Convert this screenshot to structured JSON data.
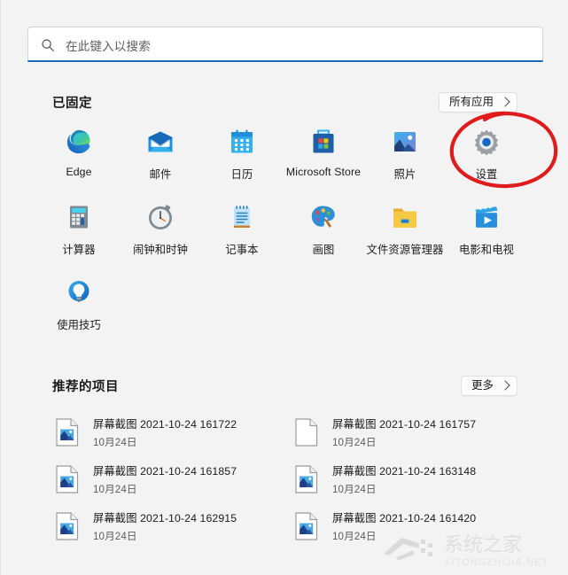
{
  "search": {
    "placeholder": "在此键入以搜索",
    "icon": "search-icon",
    "accent_color": "#1a68b5"
  },
  "pinned": {
    "title": "已固定",
    "all_apps_label": "所有应用",
    "apps": [
      {
        "label": "Edge",
        "icon": "edge-icon"
      },
      {
        "label": "邮件",
        "icon": "mail-icon"
      },
      {
        "label": "日历",
        "icon": "calendar-icon"
      },
      {
        "label": "Microsoft Store",
        "icon": "microsoft-store-icon"
      },
      {
        "label": "照片",
        "icon": "photos-icon"
      },
      {
        "label": "设置",
        "icon": "settings-gear-icon"
      },
      {
        "label": "计算器",
        "icon": "calculator-icon"
      },
      {
        "label": "闹钟和时钟",
        "icon": "alarm-clock-icon"
      },
      {
        "label": "记事本",
        "icon": "notepad-icon"
      },
      {
        "label": "画图",
        "icon": "paint-palette-icon"
      },
      {
        "label": "文件资源管理器",
        "icon": "folder-icon"
      },
      {
        "label": "电影和电视",
        "icon": "movies-tv-icon"
      },
      {
        "label": "使用技巧",
        "icon": "lightbulb-tips-icon"
      }
    ]
  },
  "recommended": {
    "title": "推荐的项目",
    "more_label": "更多",
    "items": [
      {
        "name": "屏幕截图 2021-10-24 161722",
        "date": "10月24日",
        "icon": "image-file-icon"
      },
      {
        "name": "屏幕截图 2021-10-24 161757",
        "date": "10月24日",
        "icon": "blank-file-icon"
      },
      {
        "name": "屏幕截图 2021-10-24 161857",
        "date": "10月24日",
        "icon": "image-file-icon"
      },
      {
        "name": "屏幕截图 2021-10-24 163148",
        "date": "10月24日",
        "icon": "image-file-icon"
      },
      {
        "name": "屏幕截图 2021-10-24 162915",
        "date": "10月24日",
        "icon": "image-file-icon"
      },
      {
        "name": "屏幕截图 2021-10-24 161420",
        "date": "10月24日",
        "icon": "image-file-icon"
      }
    ]
  },
  "annotation": {
    "shape": "hand-drawn-red-circle",
    "target": "设置",
    "color": "#e01b1b"
  },
  "watermark": {
    "text_cn": "系统之家",
    "text_en": "XITONGZHIJIA.NET"
  }
}
